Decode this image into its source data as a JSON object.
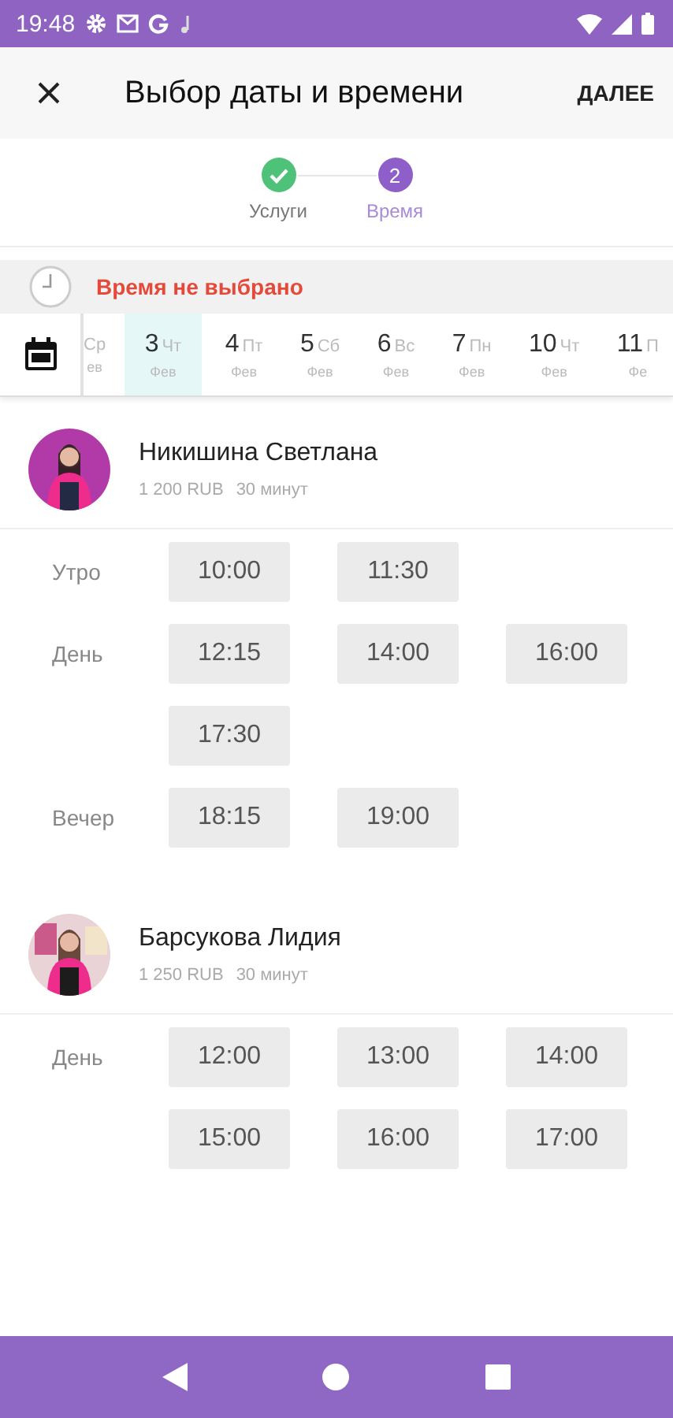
{
  "status_bar": {
    "time": "19:48"
  },
  "app_bar": {
    "title": "Выбор даты и времени",
    "action": "ДАЛЕЕ"
  },
  "stepper": [
    {
      "label": "Услуги",
      "done": true,
      "selected": false
    },
    {
      "label": "Время",
      "done": false,
      "selected": true,
      "number": "2"
    }
  ],
  "warning": {
    "text": "Время не выбрано"
  },
  "dates": [
    {
      "weekday": "Ср",
      "month": "ев",
      "selected": false
    },
    {
      "day": "3",
      "weekday": "Чт",
      "month": "Фев",
      "selected": true
    },
    {
      "day": "4",
      "weekday": "Пт",
      "month": "Фев",
      "selected": false
    },
    {
      "day": "5",
      "weekday": "Сб",
      "month": "Фев",
      "selected": false
    },
    {
      "day": "6",
      "weekday": "Вс",
      "month": "Фев",
      "selected": false
    },
    {
      "day": "7",
      "weekday": "Пн",
      "month": "Фев",
      "selected": false
    },
    {
      "day": "10",
      "weekday": "Чт",
      "month": "Фев",
      "selected": false
    },
    {
      "day": "11",
      "weekday": "П",
      "month": "Фе",
      "selected": false
    }
  ],
  "specialists": [
    {
      "name": "Никишина Светлана",
      "price": "1 200 RUB",
      "duration": "30 минут",
      "periods": [
        {
          "label": "Утро",
          "slots": [
            "10:00",
            "11:30"
          ]
        },
        {
          "label": "День",
          "slots": [
            "12:15",
            "14:00",
            "16:00",
            "17:30"
          ]
        },
        {
          "label": "Вечер",
          "slots": [
            "18:15",
            "19:00"
          ]
        }
      ]
    },
    {
      "name": "Барсукова Лидия",
      "price": "1 250 RUB",
      "duration": "30 минут",
      "periods": [
        {
          "label": "День",
          "slots": [
            "12:00",
            "13:00",
            "14:00",
            "15:00",
            "16:00",
            "17:00"
          ]
        }
      ]
    }
  ]
}
